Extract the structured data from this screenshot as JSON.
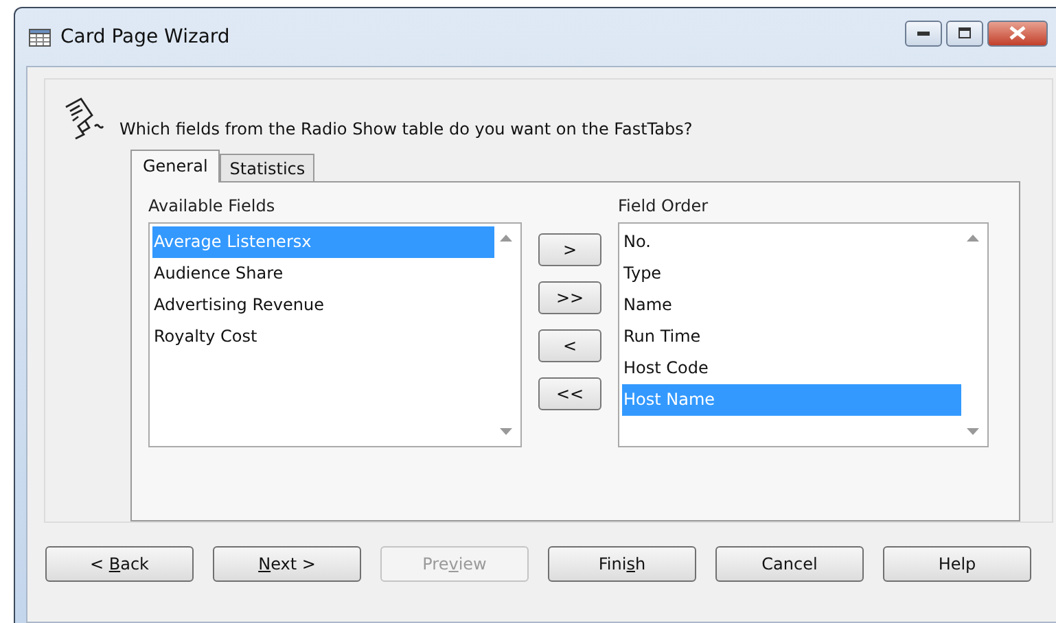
{
  "window": {
    "title": "Card Page Wizard"
  },
  "prompt": "Which fields from the Radio Show table do you want on the FastTabs?",
  "tabs": [
    {
      "label": "General",
      "selected": true
    },
    {
      "label": "Statistics",
      "selected": false
    }
  ],
  "available_fields": {
    "label": "Available Fields",
    "items": [
      {
        "text": "Average Listenersx",
        "selected": true
      },
      {
        "text": "Audience Share",
        "selected": false
      },
      {
        "text": "Advertising Revenue",
        "selected": false
      },
      {
        "text": "Royalty Cost",
        "selected": false
      }
    ]
  },
  "move_buttons": [
    ">",
    ">>",
    "<",
    "<<"
  ],
  "field_order": {
    "label": "Field Order",
    "items": [
      {
        "text": "No.",
        "selected": false
      },
      {
        "text": "Type",
        "selected": false
      },
      {
        "text": "Name",
        "selected": false
      },
      {
        "text": "Run Time",
        "selected": false
      },
      {
        "text": "Host Code",
        "selected": false
      },
      {
        "text": "Host Name",
        "selected": true
      }
    ]
  },
  "buttons": [
    {
      "label_before": "< ",
      "access_key": "B",
      "label_after": "ack",
      "disabled": false
    },
    {
      "access_key": "N",
      "label_after": "ext >",
      "disabled": false
    },
    {
      "label_before": "Pre",
      "access_key": "v",
      "label_after": "iew",
      "disabled": true
    },
    {
      "label_before": "Fini",
      "access_key": "s",
      "label_after": "h",
      "disabled": false
    },
    {
      "label_before": "Cancel",
      "disabled": false
    },
    {
      "label_before": "Help",
      "disabled": false
    }
  ]
}
